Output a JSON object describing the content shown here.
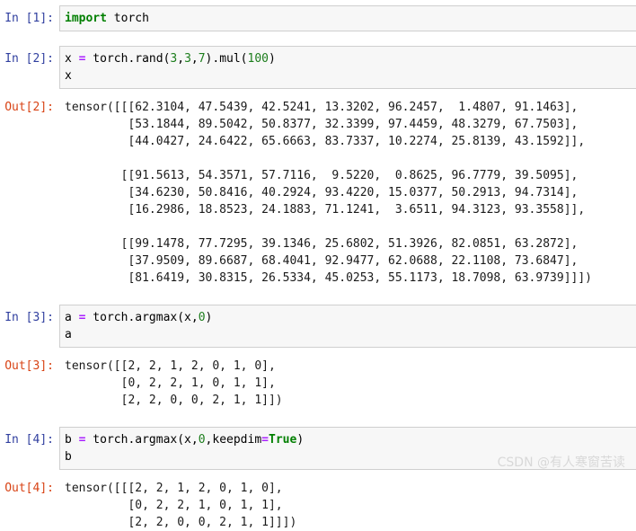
{
  "notebook": {
    "cells": [
      {
        "type": "input",
        "prompt": "In [1]:",
        "lines": [
          [
            {
              "t": "import",
              "c": "kw"
            },
            {
              "t": " torch",
              "c": "name"
            }
          ]
        ]
      },
      {
        "type": "input",
        "prompt": "In [2]:",
        "lines": [
          [
            {
              "t": "x ",
              "c": "name"
            },
            {
              "t": "=",
              "c": "op"
            },
            {
              "t": " torch.rand(",
              "c": "name"
            },
            {
              "t": "3",
              "c": "num"
            },
            {
              "t": ",",
              "c": "name"
            },
            {
              "t": "3",
              "c": "num"
            },
            {
              "t": ",",
              "c": "name"
            },
            {
              "t": "7",
              "c": "num"
            },
            {
              "t": ").mul(",
              "c": "name"
            },
            {
              "t": "100",
              "c": "num"
            },
            {
              "t": ")",
              "c": "name"
            }
          ],
          [
            {
              "t": "x",
              "c": "name"
            }
          ]
        ]
      },
      {
        "type": "output",
        "prompt": "Out[2]:",
        "text": "tensor([[[62.3104, 47.5439, 42.5241, 13.3202, 96.2457,  1.4807, 91.1463],\n         [53.1844, 89.5042, 50.8377, 32.3399, 97.4459, 48.3279, 67.7503],\n         [44.0427, 24.6422, 65.6663, 83.7337, 10.2274, 25.8139, 43.1592]],\n\n        [[91.5613, 54.3571, 57.7116,  9.5220,  0.8625, 96.7779, 39.5095],\n         [34.6230, 50.8416, 40.2924, 93.4220, 15.0377, 50.2913, 94.7314],\n         [16.2986, 18.8523, 24.1883, 71.1241,  3.6511, 94.3123, 93.3558]],\n\n        [[99.1478, 77.7295, 39.1346, 25.6802, 51.3926, 82.0851, 63.2872],\n         [37.9509, 89.6687, 68.4041, 92.9477, 62.0688, 22.1108, 73.6847],\n         [81.6419, 30.8315, 26.5334, 45.0253, 55.1173, 18.7098, 63.9739]]])"
      },
      {
        "type": "input",
        "prompt": "In [3]:",
        "lines": [
          [
            {
              "t": "a ",
              "c": "name"
            },
            {
              "t": "=",
              "c": "op"
            },
            {
              "t": " torch.argmax(x,",
              "c": "name"
            },
            {
              "t": "0",
              "c": "num"
            },
            {
              "t": ")",
              "c": "name"
            }
          ],
          [
            {
              "t": "a",
              "c": "name"
            }
          ]
        ]
      },
      {
        "type": "output",
        "prompt": "Out[3]:",
        "text": "tensor([[2, 2, 1, 2, 0, 1, 0],\n        [0, 2, 2, 1, 0, 1, 1],\n        [2, 2, 0, 0, 2, 1, 1]])"
      },
      {
        "type": "input",
        "prompt": "In [4]:",
        "lines": [
          [
            {
              "t": "b ",
              "c": "name"
            },
            {
              "t": "=",
              "c": "op"
            },
            {
              "t": " torch.argmax(x,",
              "c": "name"
            },
            {
              "t": "0",
              "c": "num"
            },
            {
              "t": ",keepdim",
              "c": "name"
            },
            {
              "t": "=",
              "c": "op"
            },
            {
              "t": "True",
              "c": "kw"
            },
            {
              "t": ")",
              "c": "name"
            }
          ],
          [
            {
              "t": "b",
              "c": "name"
            }
          ]
        ]
      },
      {
        "type": "output",
        "prompt": "Out[4]:",
        "text": "tensor([[[2, 2, 1, 2, 0, 1, 0],\n         [0, 2, 2, 1, 0, 1, 1],\n         [2, 2, 0, 0, 2, 1, 1]]])"
      }
    ]
  },
  "watermark": {
    "text": "CSDN @有人寒窗苦读"
  },
  "colors": {
    "in_prompt": "#303F9F",
    "out_prompt": "#D84315",
    "keyword": "#007F00",
    "number": "#1C7D1C",
    "operator": "#AA22FF",
    "code_background": "#f7f7f7",
    "code_border": "#cfcfcf"
  }
}
